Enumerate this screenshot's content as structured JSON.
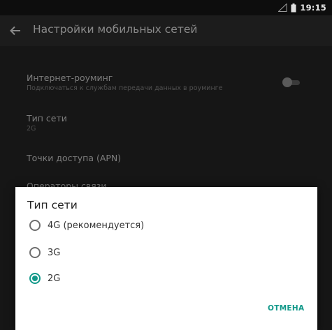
{
  "status_bar": {
    "time": "19:15",
    "icons": [
      "signal-icon",
      "battery-icon"
    ]
  },
  "app_bar": {
    "back_icon": "arrow-back-icon",
    "title": "Настройки мобильных сетей"
  },
  "settings": {
    "roaming": {
      "title": "Интернет-роуминг",
      "summary": "Подключаться к службам передачи данных в роуминге",
      "toggle_on": false
    },
    "network_type": {
      "title": "Тип сети",
      "summary": "2G"
    },
    "apn": {
      "title": "Точки доступа (APN)"
    },
    "operators": {
      "title": "Операторы связи"
    }
  },
  "dialog": {
    "title": "Тип сети",
    "options": [
      {
        "label": "4G (рекомендуется)",
        "selected": false
      },
      {
        "label": "3G",
        "selected": false
      },
      {
        "label": "2G",
        "selected": true
      }
    ],
    "cancel_label": "ОТМЕНА"
  },
  "colors": {
    "accent": "#12998a",
    "dialog_background": "#ffffff",
    "screen_dim": "#161616"
  }
}
